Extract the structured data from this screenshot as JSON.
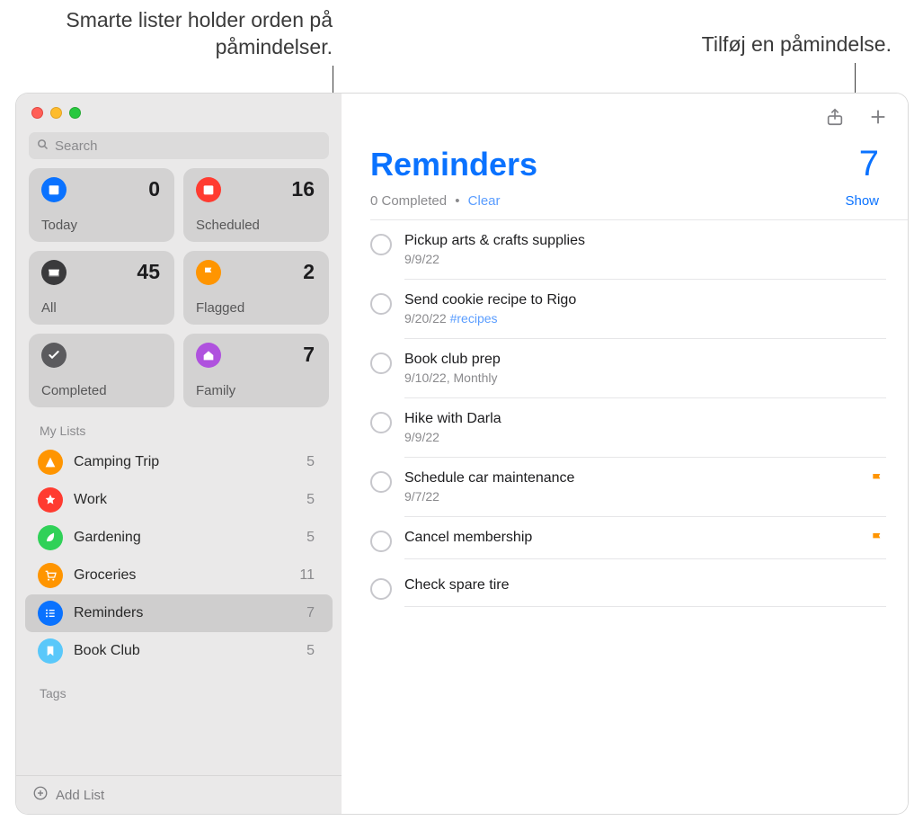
{
  "annotations": {
    "left": "Smarte lister holder orden på påmindelser.",
    "right": "Tilføj en påmindelse."
  },
  "sidebar": {
    "searchPlaceholder": "Search",
    "smartLists": [
      {
        "name": "today",
        "label": "Today",
        "count": 0,
        "color": "#0a72ff",
        "icon": "calendar"
      },
      {
        "name": "scheduled",
        "label": "Scheduled",
        "count": 16,
        "color": "#ff3b30",
        "icon": "calendar-lines"
      },
      {
        "name": "all",
        "label": "All",
        "count": 45,
        "color": "#3a3a3c",
        "icon": "inbox"
      },
      {
        "name": "flagged",
        "label": "Flagged",
        "count": 2,
        "color": "#ff9500",
        "icon": "flag"
      },
      {
        "name": "completed",
        "label": "Completed",
        "count": "",
        "color": "#5b5b5e",
        "icon": "check"
      },
      {
        "name": "family",
        "label": "Family",
        "count": 7,
        "color": "#af52de",
        "icon": "house"
      }
    ],
    "myListsHeader": "My Lists",
    "myLists": [
      {
        "name": "camping-trip",
        "label": "Camping Trip",
        "count": 5,
        "color": "#ff9500",
        "icon": "tent"
      },
      {
        "name": "work",
        "label": "Work",
        "count": 5,
        "color": "#ff3b30",
        "icon": "star"
      },
      {
        "name": "gardening",
        "label": "Gardening",
        "count": 5,
        "color": "#30d158",
        "icon": "leaf"
      },
      {
        "name": "groceries",
        "label": "Groceries",
        "count": 11,
        "color": "#ff9500",
        "icon": "cart"
      },
      {
        "name": "reminders",
        "label": "Reminders",
        "count": 7,
        "color": "#0a72ff",
        "icon": "list",
        "selected": true
      },
      {
        "name": "book-club",
        "label": "Book Club",
        "count": 5,
        "color": "#5ac8fa",
        "icon": "bookmark"
      }
    ],
    "tagsHeader": "Tags",
    "addList": "Add List"
  },
  "main": {
    "title": "Reminders",
    "count": 7,
    "completedText": "0 Completed",
    "clear": "Clear",
    "show": "Show",
    "items": [
      {
        "text": "Pickup arts & crafts supplies",
        "meta": "9/9/22"
      },
      {
        "text": "Send cookie recipe to Rigo",
        "meta": "9/20/22 ",
        "tag": "#recipes"
      },
      {
        "text": "Book club prep",
        "meta": "9/10/22, Monthly"
      },
      {
        "text": "Hike with Darla",
        "meta": "9/9/22"
      },
      {
        "text": "Schedule car maintenance",
        "meta": "9/7/22",
        "flagged": true
      },
      {
        "text": "Cancel membership",
        "flagged": true
      },
      {
        "text": "Check spare tire"
      }
    ]
  }
}
